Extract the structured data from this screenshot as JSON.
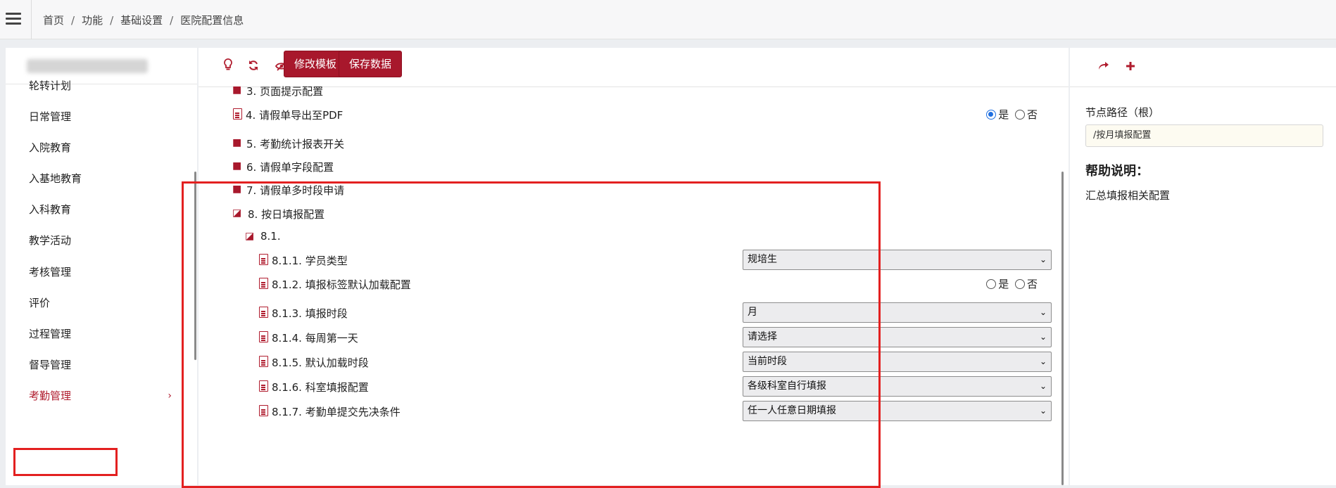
{
  "breadcrumb": {
    "items": [
      "首页",
      "功能",
      "基础设置",
      "医院配置信息"
    ],
    "separator": "/"
  },
  "sidebar": {
    "items": [
      {
        "label": "轮转计划"
      },
      {
        "label": "日常管理"
      },
      {
        "label": "入院教育"
      },
      {
        "label": "入基地教育"
      },
      {
        "label": "入科教育"
      },
      {
        "label": "教学活动"
      },
      {
        "label": "考核管理"
      },
      {
        "label": "评价"
      },
      {
        "label": "过程管理"
      },
      {
        "label": "督导管理"
      },
      {
        "label": "考勤管理",
        "active": true,
        "chevron": "›"
      }
    ]
  },
  "toolbar": {
    "icons": [
      "lightbulb-icon",
      "refresh-icon",
      "eye-slash-icon",
      "undo-icon"
    ],
    "edit_template_label": "修改模板",
    "save_data_label": "保存数据"
  },
  "tree": {
    "rows": [
      {
        "label": "3. 页面提示配置",
        "icon": "folder"
      },
      {
        "label": "4. 请假单导出至PDF",
        "icon": "doc",
        "radio": {
          "yes": "是",
          "no": "否",
          "selected": "yes"
        }
      },
      {
        "label": "5. 考勤统计报表开关",
        "icon": "folder"
      },
      {
        "label": "6. 请假单字段配置",
        "icon": "folder"
      },
      {
        "label": "7. 请假单多时段申请",
        "icon": "folder"
      },
      {
        "label": "8. 按日填报配置",
        "icon": "folder-open"
      },
      {
        "label": "8.1.",
        "icon": "folder-open"
      },
      {
        "label": "8.1.1. 学员类型",
        "icon": "doc",
        "select": "规培生"
      },
      {
        "label": "8.1.2. 填报标签默认加载配置",
        "icon": "doc",
        "radio": {
          "yes": "是",
          "no": "否",
          "selected": "none"
        }
      },
      {
        "label": "8.1.3. 填报时段",
        "icon": "doc",
        "select": "月"
      },
      {
        "label": "8.1.4. 每周第一天",
        "icon": "doc",
        "select": "请选择"
      },
      {
        "label": "8.1.5. 默认加载时段",
        "icon": "doc",
        "select": "当前时段"
      },
      {
        "label": "8.1.6. 科室填报配置",
        "icon": "doc",
        "select": "各级科室自行填报"
      },
      {
        "label": "8.1.7. 考勤单提交先决条件",
        "icon": "doc",
        "select": "任一人任意日期填报"
      }
    ]
  },
  "right_panel": {
    "icons": [
      "share-icon",
      "plus-icon"
    ],
    "node_path_label": "节点路径（根）",
    "node_path_value": "/按月填报配置",
    "help_title": "帮助说明：",
    "help_text": "汇总填报相关配置"
  },
  "colors": {
    "accent": "#a8182c",
    "highlight": "#e32020",
    "radio_selected": "#1f6fe0"
  }
}
